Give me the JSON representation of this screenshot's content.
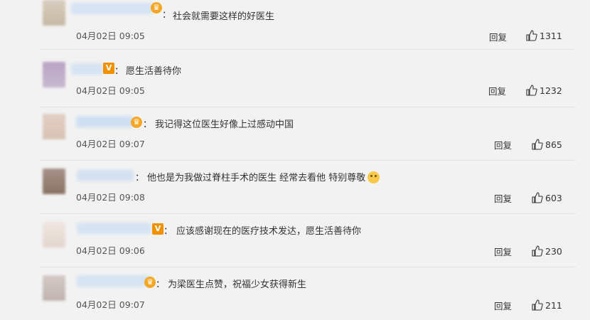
{
  "comments": [
    {
      "text": "社会就需要这样的好医生",
      "time": "04月02日 09:05",
      "reply": "回复",
      "likes": "1311",
      "badge": "crown"
    },
    {
      "text": "愿生活善待你",
      "time": "04月02日 09:05",
      "reply": "回复",
      "likes": "1232",
      "badge": "v"
    },
    {
      "text": "我记得这位医生好像上过感动中国",
      "time": "04月02日 09:07",
      "reply": "回复",
      "likes": "865",
      "badge": "crown"
    },
    {
      "text": "他也是为我做过脊柱手术的医生 经常去看他 特别尊敬",
      "time": "04月02日 09:08",
      "reply": "回复",
      "likes": "603",
      "badge": "none",
      "emoji": "sad-face-emoji"
    },
    {
      "text": "应该感谢现在的医疗技术发达，愿生活善待你",
      "time": "04月02日 09:06",
      "reply": "回复",
      "likes": "230",
      "badge": "v"
    },
    {
      "text": "为梁医生点赞，祝福少女获得新生",
      "time": "04月02日 09:07",
      "reply": "回复",
      "likes": "211",
      "badge": "crown"
    }
  ],
  "colors": {
    "background": "#f2f2f2",
    "divider": "#e3e3e3",
    "badge_v": "#f29100",
    "badge_crown": "#f5a623"
  },
  "icons": {
    "like": "thumbs-up-icon",
    "vip": "vip-v-icon",
    "member": "crown-icon"
  }
}
